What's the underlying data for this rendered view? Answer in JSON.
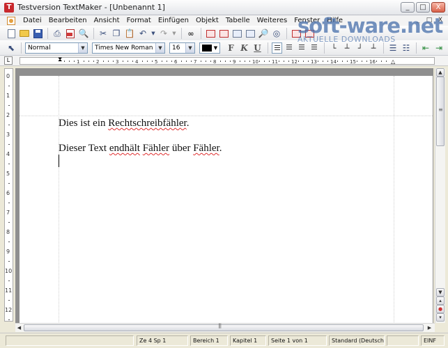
{
  "window": {
    "title": "Testversion TextMaker - [Unbenannt 1]",
    "app_icon_letter": "T",
    "controls": [
      "_",
      "□",
      "X"
    ]
  },
  "menu": {
    "items": [
      "Datei",
      "Bearbeiten",
      "Ansicht",
      "Format",
      "Einfügen",
      "Objekt",
      "Tabelle",
      "Weiteres",
      "Fenster",
      "Hilfe"
    ],
    "doc_controls": [
      "_",
      "□",
      "X"
    ]
  },
  "format_bar": {
    "style": "Normal",
    "font": "Times New Roman",
    "size": "16",
    "color": "#000000"
  },
  "watermark": {
    "main": "soft-ware.net",
    "sub": "AKTUELLE DOWNLOADS"
  },
  "ruler": {
    "h_ticks": [
      "1",
      "2",
      "3",
      "4",
      "5",
      "6",
      "7",
      "8",
      "9",
      "10",
      "11",
      "12",
      "13",
      "14",
      "15",
      "16"
    ],
    "v_ticks": [
      "0",
      "1",
      "2",
      "3",
      "4",
      "5",
      "6",
      "7",
      "8",
      "9",
      "10",
      "11",
      "12"
    ]
  },
  "document": {
    "para1": {
      "before": "Dies ist ein ",
      "misspelled": "Rechtschreibfähler",
      "after": "."
    },
    "para2": {
      "s1": "Dieser Text ",
      "m1": "endhält",
      "s2": " ",
      "m2": "Fähler",
      "s3": " über ",
      "m3": "Fähler",
      "s4": "."
    }
  },
  "statusbar": {
    "position": "Ze 4 Sp 1",
    "area": "Bereich 1",
    "chapter": "Kapitel 1",
    "page": "Seite 1 von 1",
    "language": "Standard (Deutsch",
    "mode": "EINF"
  },
  "colors": {
    "spell_error": "#e03030",
    "watermark": "#466eaa"
  }
}
